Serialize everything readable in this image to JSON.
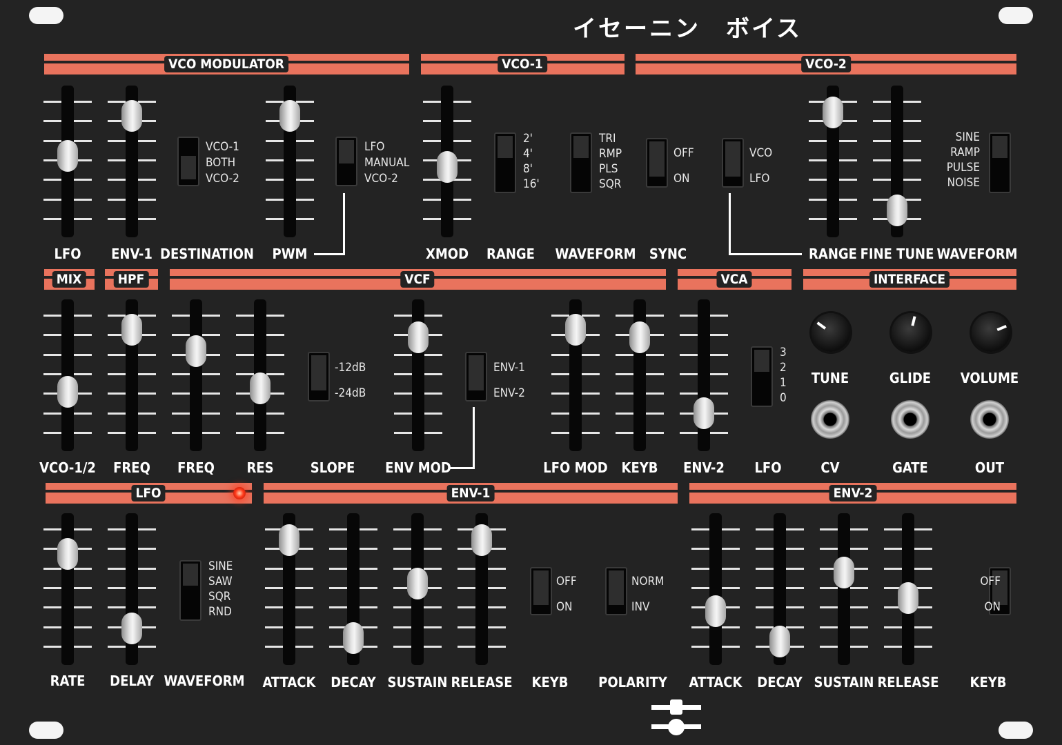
{
  "title": "イセーニン　ボイス",
  "colors": {
    "panel": "#232323",
    "accent": "#e9735d",
    "text": "#ffffff",
    "led": "#ff3a1a"
  },
  "sections": [
    {
      "id": "vco-modulator",
      "label": "VCO MODULATOR"
    },
    {
      "id": "vco-1",
      "label": "VCO-1"
    },
    {
      "id": "vco-2",
      "label": "VCO-2"
    },
    {
      "id": "mix",
      "label": "MIX"
    },
    {
      "id": "hpf",
      "label": "HPF"
    },
    {
      "id": "vcf",
      "label": "VCF"
    },
    {
      "id": "vca",
      "label": "VCA"
    },
    {
      "id": "interface",
      "label": "INTERFACE"
    },
    {
      "id": "lfo",
      "label": "LFO"
    },
    {
      "id": "env-1",
      "label": "ENV-1"
    },
    {
      "id": "env-2",
      "label": "ENV-2"
    }
  ],
  "faders": [
    {
      "id": "vcomod-lfo",
      "label": "LFO",
      "value": 0.55
    },
    {
      "id": "vcomod-env1",
      "label": "ENV-1",
      "value": 0.92
    },
    {
      "id": "vcomod-pwm",
      "label": "PWM",
      "value": 0.92
    },
    {
      "id": "vco1-xmod",
      "label": "XMOD",
      "value": 0.45
    },
    {
      "id": "vco2-range",
      "label": "RANGE",
      "value": 0.95
    },
    {
      "id": "vco2-finetune",
      "label": "FINE TUNE",
      "value": 0.05
    },
    {
      "id": "mix-vco12",
      "label": "VCO-1/2",
      "value": 0.35
    },
    {
      "id": "hpf-freq",
      "label": "FREQ",
      "value": 0.92
    },
    {
      "id": "vcf-freq",
      "label": "FREQ",
      "value": 0.72
    },
    {
      "id": "vcf-res",
      "label": "RES",
      "value": 0.38
    },
    {
      "id": "vcf-envmod",
      "label": "ENV MOD",
      "value": 0.85
    },
    {
      "id": "vcf-lfomod",
      "label": "LFO MOD",
      "value": 0.92
    },
    {
      "id": "vcf-keyb",
      "label": "KEYB",
      "value": 0.85
    },
    {
      "id": "vca-env2",
      "label": "ENV-2",
      "value": 0.15
    },
    {
      "id": "lfo-rate",
      "label": "RATE",
      "value": 0.82
    },
    {
      "id": "lfo-delay",
      "label": "DELAY",
      "value": 0.14
    },
    {
      "id": "env1-attack",
      "label": "ATTACK",
      "value": 0.95
    },
    {
      "id": "env1-decay",
      "label": "DECAY",
      "value": 0.05
    },
    {
      "id": "env1-sustain",
      "label": "SUSTAIN",
      "value": 0.55
    },
    {
      "id": "env1-release",
      "label": "RELEASE",
      "value": 0.95
    },
    {
      "id": "env2-attack",
      "label": "ATTACK",
      "value": 0.3
    },
    {
      "id": "env2-decay",
      "label": "DECAY",
      "value": 0.02
    },
    {
      "id": "env2-sustain",
      "label": "SUSTAIN",
      "value": 0.65
    },
    {
      "id": "env2-release",
      "label": "RELEASE",
      "value": 0.42
    }
  ],
  "switches": [
    {
      "id": "destination",
      "label": "DESTINATION",
      "options": [
        "VCO-1",
        "BOTH",
        "VCO-2"
      ],
      "selected": 1
    },
    {
      "id": "pwm-source",
      "label": "",
      "options": [
        "LFO",
        "MANUAL",
        "VCO-2"
      ],
      "selected": 0
    },
    {
      "id": "vco1-range",
      "label": "RANGE",
      "options": [
        "2'",
        "4'",
        "8'",
        "16'"
      ],
      "selected": 0
    },
    {
      "id": "vco1-waveform",
      "label": "WAVEFORM",
      "options": [
        "TRI",
        "RMP",
        "PLS",
        "SQR"
      ],
      "selected": 0
    },
    {
      "id": "sync",
      "label": "SYNC",
      "options": [
        "OFF",
        "ON"
      ],
      "selected": 0
    },
    {
      "id": "vco2-mod",
      "label": "",
      "options": [
        "VCO",
        "LFO"
      ],
      "selected": 0
    },
    {
      "id": "vco2-waveform",
      "label": "WAVEFORM",
      "options": [
        "SINE",
        "RAMP",
        "PULSE",
        "NOISE"
      ],
      "selected": 0
    },
    {
      "id": "vcf-slope",
      "label": "SLOPE",
      "options": [
        "-12dB",
        "-24dB"
      ],
      "selected": 0
    },
    {
      "id": "vcf-envsel",
      "label": "",
      "options": [
        "ENV-1",
        "ENV-2"
      ],
      "selected": 0
    },
    {
      "id": "vca-lfo",
      "label": "LFO",
      "options": [
        "3",
        "2",
        "1",
        "0"
      ],
      "selected": 0
    },
    {
      "id": "lfo-waveform",
      "label": "WAVEFORM",
      "options": [
        "SINE",
        "SAW",
        "SQR",
        "RND"
      ],
      "selected": 0
    },
    {
      "id": "env1-keyb",
      "label": "KEYB",
      "options": [
        "OFF",
        "ON"
      ],
      "selected": 0
    },
    {
      "id": "env1-polarity",
      "label": "POLARITY",
      "options": [
        "NORM",
        "INV"
      ],
      "selected": 0
    },
    {
      "id": "env2-keyb",
      "label": "KEYB",
      "options": [
        "OFF",
        "ON"
      ],
      "selected": 0
    }
  ],
  "knobs": [
    {
      "id": "tune",
      "label": "TUNE",
      "value": 0.3
    },
    {
      "id": "glide",
      "label": "GLIDE",
      "value": 0.55
    },
    {
      "id": "volume",
      "label": "VOLUME",
      "value": 0.75
    }
  ],
  "jacks": [
    {
      "id": "cv",
      "label": "CV"
    },
    {
      "id": "gate",
      "label": "GATE"
    },
    {
      "id": "out",
      "label": "OUT"
    }
  ],
  "logo_icon": "fader-logo-icon"
}
